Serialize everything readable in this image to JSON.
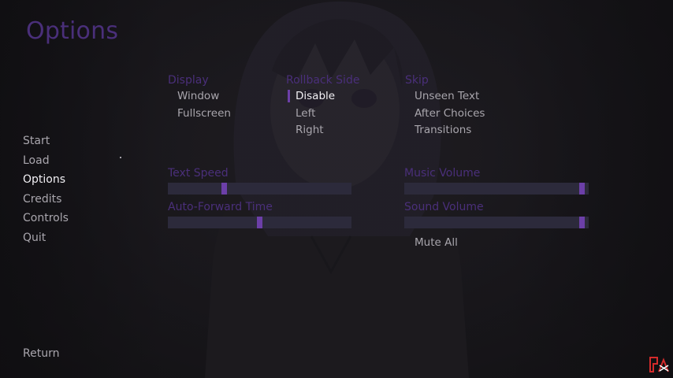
{
  "screen": {
    "title": "Options",
    "nav": {
      "items": [
        {
          "label": "Start"
        },
        {
          "label": "Load"
        },
        {
          "label": "Options"
        },
        {
          "label": "Credits"
        },
        {
          "label": "Controls"
        },
        {
          "label": "Quit"
        }
      ],
      "active": "Options",
      "return_label": "Return"
    },
    "display": {
      "header": "Display",
      "options": [
        "Window",
        "Fullscreen"
      ],
      "selected": null
    },
    "rollback": {
      "header": "Rollback Side",
      "options": [
        "Disable",
        "Left",
        "Right"
      ],
      "selected": "Disable"
    },
    "skip": {
      "header": "Skip",
      "options": [
        "Unseen Text",
        "After Choices",
        "Transitions"
      ],
      "selected": null
    },
    "sliders": {
      "text_speed": {
        "label": "Text Speed",
        "value": 0.3
      },
      "auto_forward": {
        "label": "Auto-Forward Time",
        "value": 0.5
      },
      "music_volume": {
        "label": "Music Volume",
        "value": 0.98
      },
      "sound_volume": {
        "label": "Sound Volume",
        "value": 0.98
      }
    },
    "mute_all_label": "Mute All",
    "colors": {
      "accent": "#6c3fa8",
      "header": "#4a2f7a",
      "text": "#a9a6ad",
      "active_text": "#f2f0f4",
      "slider_track": "#2c2a3b",
      "logo": "#d42b2b"
    },
    "icons": {
      "corner_logo": "studio-logo-icon"
    }
  }
}
